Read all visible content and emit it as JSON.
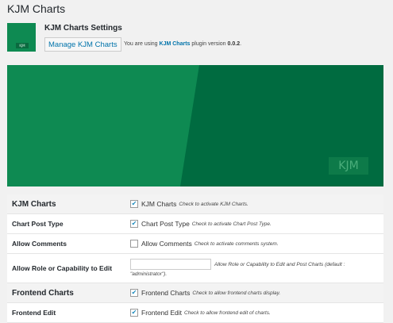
{
  "page": {
    "title": "KJM Charts"
  },
  "header": {
    "logo_text": "KJM",
    "settings_title": "KJM Charts Settings",
    "manage_button": "Manage KJM Charts",
    "version_prefix": "You are using",
    "plugin_name": "KJM Charts",
    "version_mid": "plugin version",
    "version_number": "0.0.2",
    "version_suffix": "."
  },
  "banner": {
    "badge": "KJM",
    "colors": {
      "dark": "#006b40",
      "light": "#0e8a52"
    }
  },
  "settings": {
    "kjm_charts": {
      "section_label": "KJM Charts",
      "checked": true,
      "option_label": "KJM Charts",
      "desc": "Check to activate KJM Charts."
    },
    "chart_post_type": {
      "label": "Chart Post Type",
      "checked": true,
      "option_label": "Chart Post Type",
      "desc": "Check to activate Chart Post Type."
    },
    "allow_comments": {
      "label": "Allow Comments",
      "checked": false,
      "option_label": "Allow Comments",
      "desc": "Check to activate comments system."
    },
    "allow_role": {
      "label": "Allow Role or Capability to Edit",
      "value": "",
      "desc_line1": "Allow Role or Capability to Edit and Post Charts (default :",
      "desc_line2": "\"administrator\")."
    },
    "frontend_charts": {
      "section_label": "Frontend Charts",
      "checked": true,
      "option_label": "Frontend Charts",
      "desc": "Check to allow frontend charts display."
    },
    "frontend_edit": {
      "label": "Frontend Edit",
      "checked": true,
      "option_label": "Frontend Edit",
      "desc": "Check to allow frontend edit of charts."
    }
  }
}
